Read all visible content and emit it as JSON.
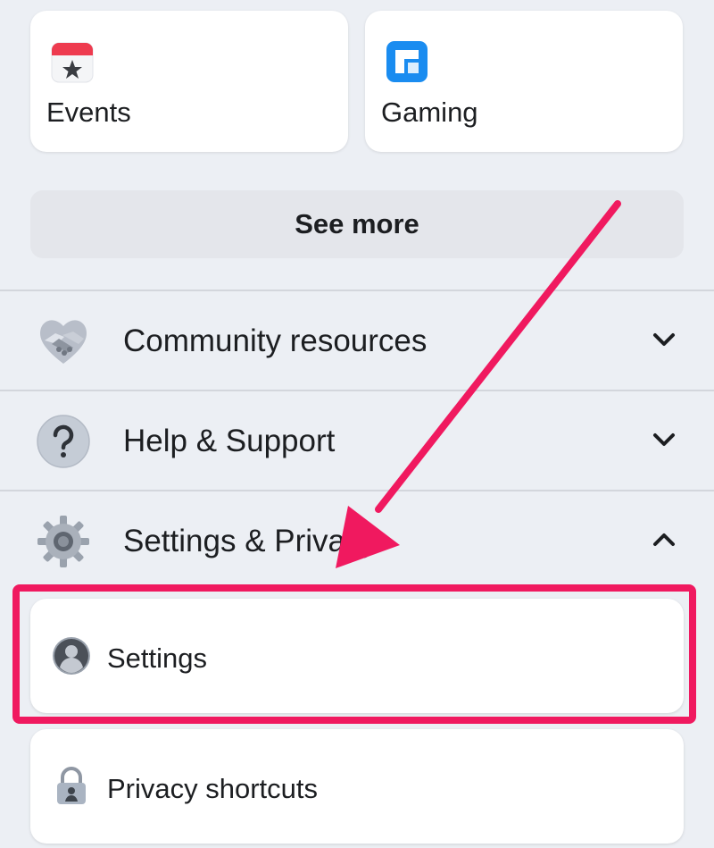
{
  "shortcuts": [
    {
      "label": "Events",
      "icon": "calendar-star-icon"
    },
    {
      "label": "Gaming",
      "icon": "gaming-icon"
    }
  ],
  "see_more": {
    "label": "See more"
  },
  "sections": [
    {
      "label": "Community resources",
      "icon": "handshake-icon",
      "expanded": false
    },
    {
      "label": "Help & Support",
      "icon": "question-circle-icon",
      "expanded": false
    },
    {
      "label": "Settings & Privacy",
      "icon": "gear-icon",
      "expanded": true
    }
  ],
  "settings_privacy": {
    "items": [
      {
        "label": "Settings",
        "icon": "profile-avatar-icon",
        "highlighted": true
      },
      {
        "label": "Privacy shortcuts",
        "icon": "lock-icon",
        "highlighted": false
      }
    ]
  },
  "annotation": {
    "color": "#f0195f",
    "arrow_icon": "pointer-arrow-icon"
  },
  "colors": {
    "background": "#eceff4",
    "card": "#ffffff",
    "button": "#e4e6eb",
    "gaming_blue": "#1a8cf0",
    "events_red": "#ee3b4f"
  }
}
